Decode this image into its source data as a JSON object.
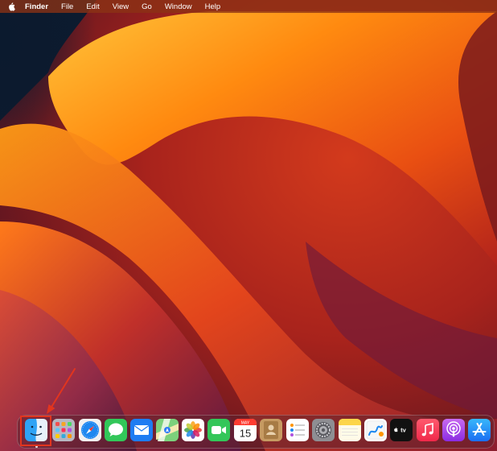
{
  "menubar": {
    "apple_icon": "apple-logo-icon",
    "items": [
      "Finder",
      "File",
      "Edit",
      "View",
      "Go",
      "Window",
      "Help"
    ]
  },
  "dock": {
    "apps": [
      {
        "icon": "finder-icon",
        "running": true,
        "highlighted": true
      },
      {
        "icon": "launchpad-icon"
      },
      {
        "icon": "safari-icon"
      },
      {
        "icon": "messages-icon"
      },
      {
        "icon": "mail-icon"
      },
      {
        "icon": "maps-icon"
      },
      {
        "icon": "photos-icon"
      },
      {
        "icon": "facetime-icon"
      },
      {
        "icon": "calendar-icon",
        "month": "MAY",
        "day": "15"
      },
      {
        "icon": "contacts-icon"
      },
      {
        "icon": "reminders-icon"
      },
      {
        "icon": "system-settings-icon"
      },
      {
        "icon": "notes-icon"
      },
      {
        "icon": "freeform-icon"
      },
      {
        "icon": "apple-tv-icon",
        "label": "tv"
      },
      {
        "icon": "music-icon"
      },
      {
        "icon": "podcasts-icon"
      },
      {
        "icon": "app-store-icon"
      }
    ]
  },
  "annotation": {
    "color": "#e2351e",
    "arrow_icon": "red-arrow-icon"
  }
}
